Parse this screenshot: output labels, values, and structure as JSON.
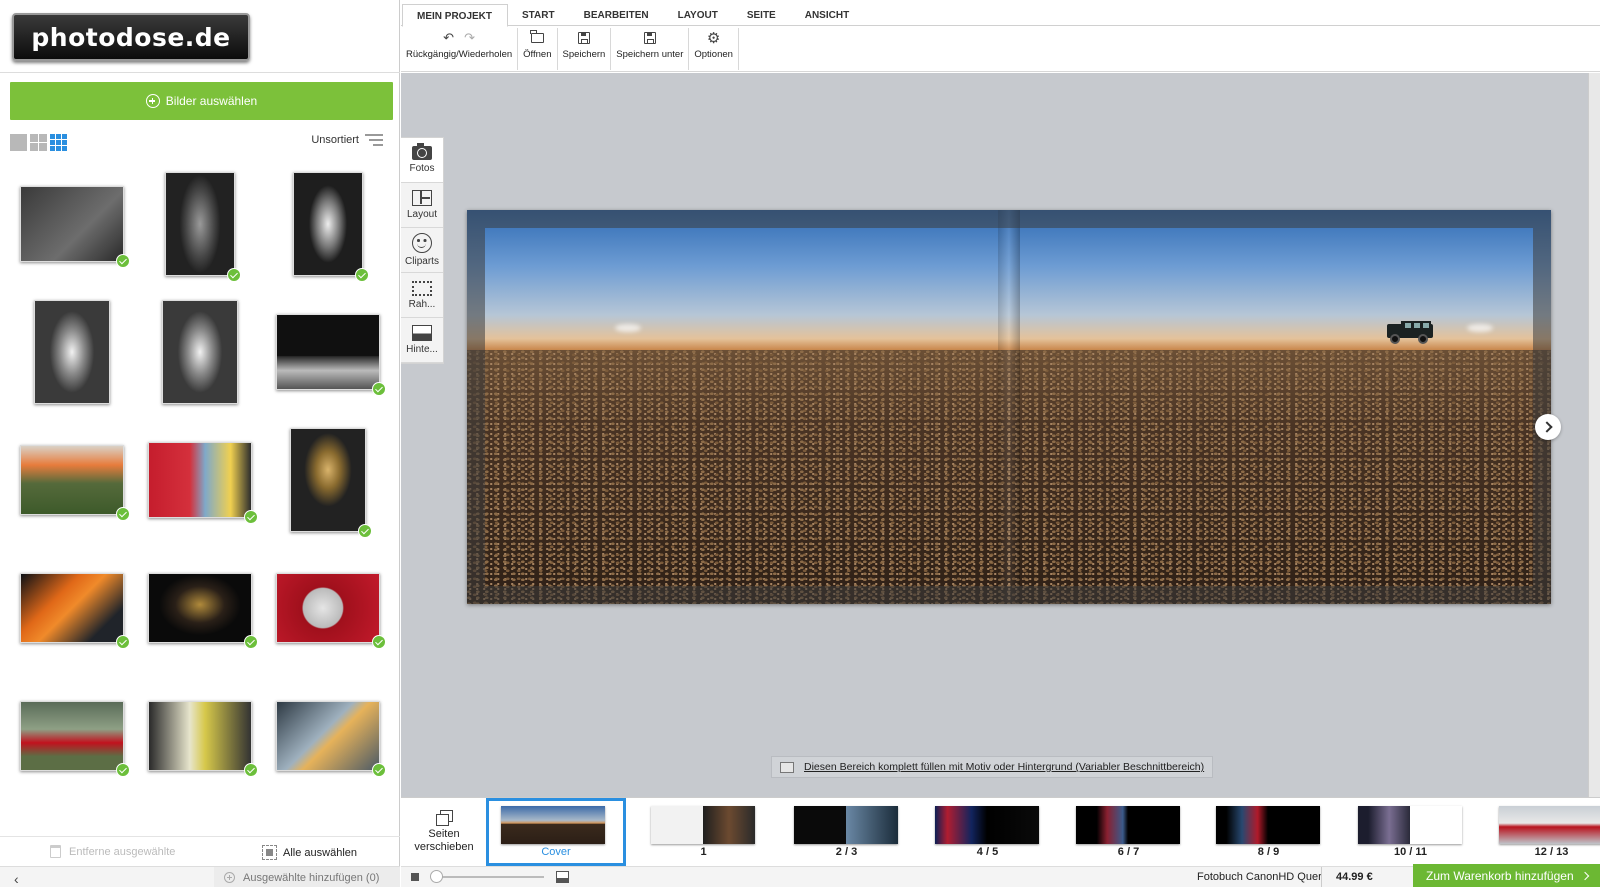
{
  "logo": {
    "text": "photodose.de"
  },
  "left_panel": {
    "select_images_button": "Bilder auswählen",
    "sort_label": "Unsortiert",
    "remove_selected": "Entferne ausgewählte",
    "select_all": "Alle auswählen",
    "add_selected": "Ausgewählte hinzufügen (0)",
    "collapse_arrow": "‹",
    "photos": [
      {
        "desc": "car-top-view-bw-1",
        "checked": true
      },
      {
        "desc": "tarmac-bw",
        "checked": true
      },
      {
        "desc": "car-top-view-bw-2",
        "checked": true
      },
      {
        "desc": "car-top-view-bw-3",
        "checked": false
      },
      {
        "desc": "car-top-view-bw-4",
        "checked": false
      },
      {
        "desc": "car-side-bw",
        "checked": true
      },
      {
        "desc": "rally-car-track",
        "checked": true
      },
      {
        "desc": "garage-cars",
        "checked": true
      },
      {
        "desc": "trophies",
        "checked": true
      },
      {
        "desc": "orange-car-engine",
        "checked": true
      },
      {
        "desc": "trophy-ceremony",
        "checked": true
      },
      {
        "desc": "fuel-cap-red",
        "checked": true
      },
      {
        "desc": "red-audi-tt",
        "checked": true
      },
      {
        "desc": "rally-car-pit",
        "checked": true
      },
      {
        "desc": "food-in-car",
        "checked": true
      }
    ]
  },
  "ribbon": {
    "tabs": [
      "MEIN PROJEKT",
      "START",
      "BEARBEITEN",
      "LAYOUT",
      "SEITE",
      "ANSICHT"
    ],
    "active_tab": "MEIN PROJEKT",
    "tools": {
      "undo_redo": "Rückgängig/Wiederholen",
      "open": "Öffnen",
      "save": "Speichern",
      "save_as": "Speichern unter",
      "options": "Optionen"
    }
  },
  "side_tools": [
    "Fotos",
    "Layout",
    "Cliparts",
    "Rah...",
    "Hinte..."
  ],
  "canvas": {
    "fill_option": "Diesen Bereich komplett füllen mit Motiv oder Hintergrund (Variabler Beschnittbereich)"
  },
  "strip": {
    "move_pages": "Seiten verschieben",
    "pages": [
      "Cover",
      "1",
      "2 / 3",
      "4 / 5",
      "6 / 7",
      "8 / 9",
      "10 / 11",
      "12 / 13"
    ],
    "selected_page": "Cover"
  },
  "bottom": {
    "product": "Fotobuch CanonHD Quer",
    "price": "44.99 €",
    "add_to_cart": "Zum Warenkorb hinzufügen",
    "zoom_level": 0
  },
  "colors": {
    "accent_green": "#7cc13a",
    "cart_green": "#6cb833",
    "selection_blue": "#2a8fe0",
    "canvas_bg": "#c6c9ce"
  }
}
